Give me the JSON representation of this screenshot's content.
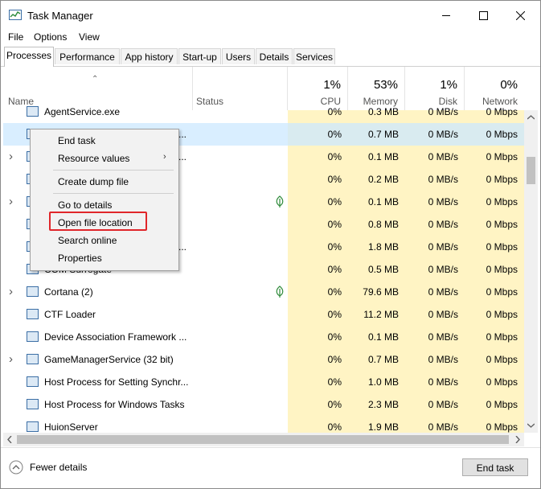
{
  "window": {
    "title": "Task Manager"
  },
  "menu": [
    "File",
    "Options",
    "View"
  ],
  "tabs": [
    "Processes",
    "Performance",
    "App history",
    "Start-up",
    "Users",
    "Details",
    "Services"
  ],
  "columns": {
    "name": "Name",
    "status": "Status",
    "cpu": {
      "pct": "1%",
      "label": "CPU"
    },
    "memory": {
      "pct": "53%",
      "label": "Memory"
    },
    "disk": {
      "pct": "1%",
      "label": "Disk"
    },
    "network": {
      "pct": "0%",
      "label": "Network"
    }
  },
  "rows": [
    {
      "name": "AgentService.exe",
      "cpu": "0%",
      "memory": "0.3 MB",
      "disk": "0 MB/s",
      "network": "0 Mbps",
      "expandable": false
    },
    {
      "name": "",
      "cpu": "0%",
      "memory": "0.7 MB",
      "disk": "0 MB/s",
      "network": "0 Mbps",
      "expandable": false,
      "selected": true,
      "trailing": "..."
    },
    {
      "name": "",
      "cpu": "0%",
      "memory": "0.1 MB",
      "disk": "0 MB/s",
      "network": "0 Mbps",
      "expandable": true,
      "trailing": "..."
    },
    {
      "name": "",
      "cpu": "0%",
      "memory": "0.2 MB",
      "disk": "0 MB/s",
      "network": "0 Mbps",
      "expandable": false
    },
    {
      "name": "",
      "cpu": "0%",
      "memory": "0.1 MB",
      "disk": "0 MB/s",
      "network": "0 Mbps",
      "expandable": true,
      "leaf": true
    },
    {
      "name": "",
      "cpu": "0%",
      "memory": "0.8 MB",
      "disk": "0 MB/s",
      "network": "0 Mbps",
      "expandable": false
    },
    {
      "name": "",
      "cpu": "0%",
      "memory": "1.8 MB",
      "disk": "0 MB/s",
      "network": "0 Mbps",
      "expandable": false,
      "trailing": "..."
    },
    {
      "name": "COM Surrogate",
      "cpu": "0%",
      "memory": "0.5 MB",
      "disk": "0 MB/s",
      "network": "0 Mbps",
      "expandable": false
    },
    {
      "name": "Cortana (2)",
      "cpu": "0%",
      "memory": "79.6 MB",
      "disk": "0 MB/s",
      "network": "0 Mbps",
      "expandable": true,
      "leaf": true
    },
    {
      "name": "CTF Loader",
      "cpu": "0%",
      "memory": "11.2 MB",
      "disk": "0 MB/s",
      "network": "0 Mbps",
      "expandable": false
    },
    {
      "name": "Device Association Framework ...",
      "cpu": "0%",
      "memory": "0.1 MB",
      "disk": "0 MB/s",
      "network": "0 Mbps",
      "expandable": false
    },
    {
      "name": "GameManagerService (32 bit)",
      "cpu": "0%",
      "memory": "0.7 MB",
      "disk": "0 MB/s",
      "network": "0 Mbps",
      "expandable": true
    },
    {
      "name": "Host Process for Setting Synchr...",
      "cpu": "0%",
      "memory": "1.0 MB",
      "disk": "0 MB/s",
      "network": "0 Mbps",
      "expandable": false
    },
    {
      "name": "Host Process for Windows Tasks",
      "cpu": "0%",
      "memory": "2.3 MB",
      "disk": "0 MB/s",
      "network": "0 Mbps",
      "expandable": false
    },
    {
      "name": "HuionServer",
      "cpu": "0%",
      "memory": "1.9 MB",
      "disk": "0 MB/s",
      "network": "0 Mbps",
      "expandable": false
    }
  ],
  "context_menu": {
    "end_task": "End task",
    "resource_values": "Resource values",
    "create_dump": "Create dump file",
    "go_to_details": "Go to details",
    "open_file_location": "Open file location",
    "search_online": "Search online",
    "properties": "Properties"
  },
  "footer": {
    "fewer_details": "Fewer details",
    "end_task": "End task"
  },
  "colors": {
    "cpu_tint": "#fff4c4",
    "selection": "#cce8ff",
    "highlight": "#e0262a"
  }
}
